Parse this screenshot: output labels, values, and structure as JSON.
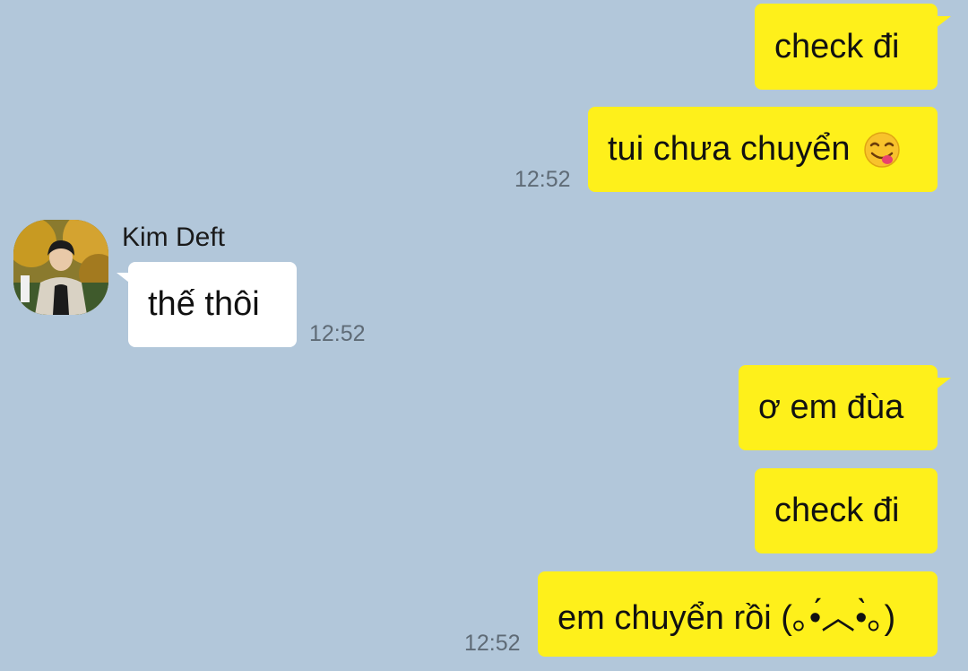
{
  "contact": {
    "name": "Kim Deft"
  },
  "messages": [
    {
      "id": "m1",
      "direction": "out",
      "text": "check đi",
      "time": ""
    },
    {
      "id": "m2",
      "direction": "out",
      "text": "tui chưa chuyển",
      "emoji": "savoring-face-emoji",
      "time": "12:52"
    },
    {
      "id": "m3",
      "direction": "in",
      "text": "thế thôi",
      "time": "12:52"
    },
    {
      "id": "m4",
      "direction": "out",
      "text": "ơ em đùa",
      "time": ""
    },
    {
      "id": "m5",
      "direction": "out",
      "text": "check đi",
      "time": ""
    },
    {
      "id": "m6",
      "direction": "out",
      "text": "em chuyển rồi (｡•́︿•̀｡)",
      "time": "12:52"
    }
  ],
  "colors": {
    "background": "#b2c7da",
    "outgoing_bubble": "#fef01b",
    "incoming_bubble": "#ffffff",
    "timestamp": "#5f6b76"
  }
}
